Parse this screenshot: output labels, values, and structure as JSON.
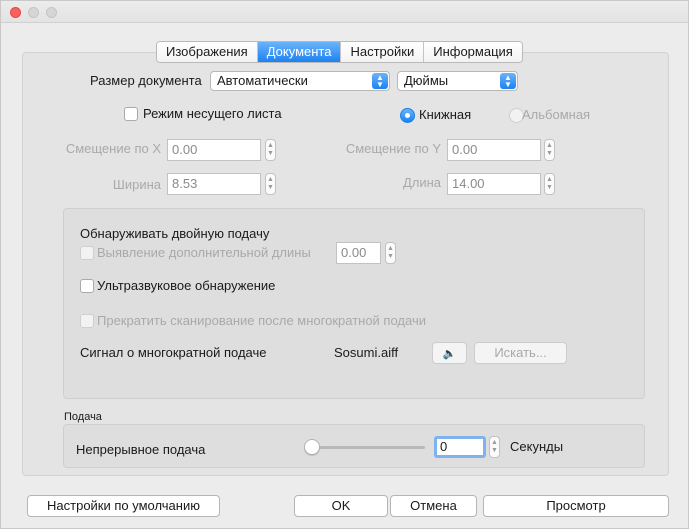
{
  "tabs": [
    {
      "label": "Изображения",
      "active": false
    },
    {
      "label": "Документа",
      "active": true
    },
    {
      "label": "Настройки",
      "active": false
    },
    {
      "label": "Информация",
      "active": false
    }
  ],
  "doc_size": {
    "label": "Размер документа",
    "size_value": "Автоматически",
    "unit_value": "Дюймы"
  },
  "carrier_sheet_label": "Режим несущего листа",
  "orientation": {
    "portrait_label": "Книжная",
    "landscape_label": "Альбомная",
    "selected": "portrait"
  },
  "offset_x": {
    "label": "Смещение по X",
    "value": "0.00"
  },
  "offset_y": {
    "label": "Смещение по Y",
    "value": "0.00"
  },
  "width": {
    "label": "Ширина",
    "value": "8.53"
  },
  "length": {
    "label": "Длина",
    "value": "14.00"
  },
  "double_feed": {
    "title": "Обнаруживать двойную подачу",
    "extra_length_label": "Выявление дополнительной длины",
    "extra_length_value": "0.00",
    "ultrasonic_label": "Ультразвуковое обнаружение",
    "stop_scan_label": "Прекратить сканирование после многократной подачи",
    "signal_label": "Сигнал о многократной подаче",
    "sound_file": "Sosumi.aiff",
    "browse_label": "Искать..."
  },
  "feed": {
    "title": "Подача",
    "continuous_label": "Непрерывное подача",
    "seconds_value": "0",
    "seconds_unit": "Секунды",
    "slider_level": 0
  },
  "buttons": {
    "defaults": "Настройки по умолчанию",
    "ok": "OK",
    "cancel": "Отмена",
    "preview": "Просмотр"
  },
  "colors": {
    "accent": "#1b82f2",
    "traffic_close": "#fc605b"
  }
}
